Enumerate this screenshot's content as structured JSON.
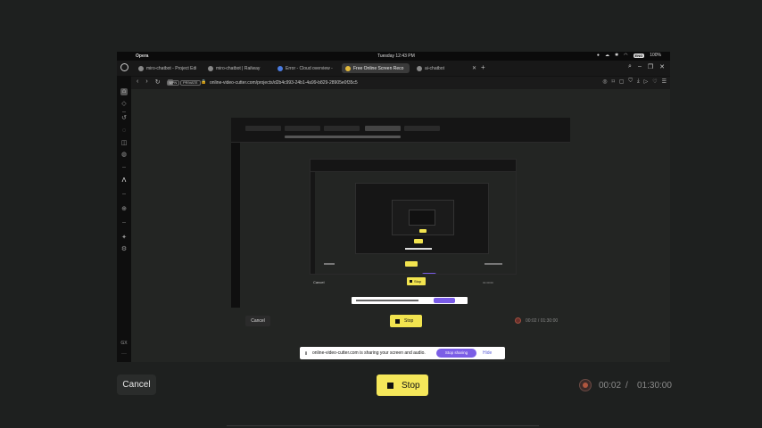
{
  "menubar": {
    "app_name": "Opera",
    "clock": "Tuesday 12:43 PM",
    "keyboard_badge": "ENG",
    "battery": "100%"
  },
  "tabs": [
    {
      "label": "miro-chatbot - Project Edi"
    },
    {
      "label": "miro-chatbot | Railway"
    },
    {
      "label": "Error - Cloud overview -"
    },
    {
      "label": "Free Online Screen Reco"
    },
    {
      "label": "ai-chatbot"
    }
  ],
  "addressbar": {
    "vpn_badge": "VPN",
    "private_badge": "PRIVATE",
    "url": "online-video-cutter.com/projects/d2b4c993-24b1-4a99-b829-28905e0f35c5"
  },
  "sidebar": {
    "label_gx": "GX",
    "more": "···"
  },
  "recorder_inner": {
    "cancel_label": "Cancel",
    "stop_label": "Stop",
    "elapsed": "00:02",
    "separator": "/",
    "total": "01:30:00"
  },
  "sharebar": {
    "message": "online-video-cutter.com is sharing your screen and audio.",
    "stop_sharing_label": "Stop sharing",
    "hide_label": "Hide"
  },
  "recorder": {
    "cancel_label": "Cancel",
    "stop_label": "Stop",
    "elapsed": "00:02",
    "separator": "/",
    "total": "01:30:00"
  },
  "colors": {
    "background": "#1e201f",
    "stop_yellow": "#f5e75a",
    "stop_sharing_purple": "#7b5ee6"
  }
}
